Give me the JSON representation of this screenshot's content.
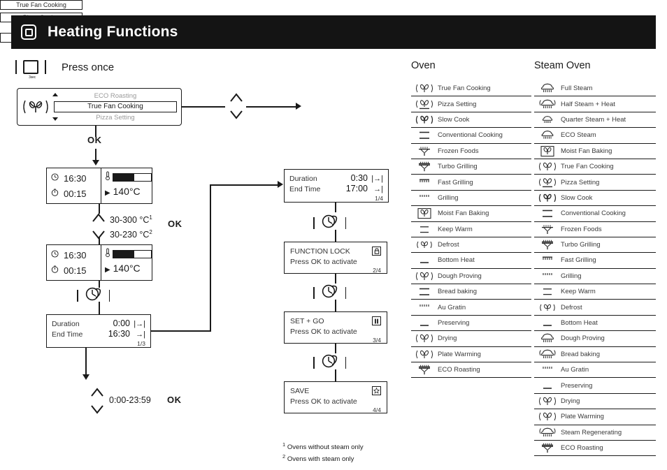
{
  "header": {
    "title": "Heating Functions",
    "icon": "square-button-icon"
  },
  "press_row": {
    "button_sublabel": "3sec",
    "label": "Press once"
  },
  "selector_panel": {
    "icon": "true-fan-cooking-icon",
    "option_above": "ECO Roasting",
    "option_selected": "True Fan Cooking",
    "option_below": "Pizza Setting"
  },
  "menu_panel": {
    "rows": [
      "True Fan Cooking",
      "Pizza Setting"
    ],
    "ellipsis": "....",
    "last_row": "ECO Roasting"
  },
  "ok_labels": {
    "after_selector": "OK",
    "after_temp": "OK",
    "after_duration": "OK"
  },
  "temp_display_1": {
    "clock_icon": "clock-icon",
    "clock_value": "16:30",
    "timer_icon": "timer-icon",
    "timer_value": "00:15",
    "thermo_icon": "thermometer-icon",
    "bar_fill_percent": 55,
    "temperature": "140°C"
  },
  "temp_display_2": {
    "clock_icon": "clock-icon",
    "clock_value": "16:30",
    "timer_icon": "timer-icon",
    "timer_value": "00:15",
    "thermo_icon": "thermometer-icon",
    "bar_fill_percent": 55,
    "temperature": "140°C"
  },
  "temp_range": {
    "line1": "30-300 °C",
    "sup1": "1",
    "line2": "30-230 °C",
    "sup2": "2"
  },
  "duration_display_1": {
    "duration_label": "Duration",
    "duration_value": "0:00",
    "duration_arrow": "|→|",
    "endtime_label": "End Time",
    "endtime_value": "16:30",
    "endtime_arrow": "→|",
    "page": "1/3"
  },
  "duration_range": "0:00-23:59",
  "duration_display_2": {
    "duration_label": "Duration",
    "duration_value": "0:30",
    "duration_arrow": "|→|",
    "endtime_label": "End Time",
    "endtime_value": "17:00",
    "endtime_arrow": "→|",
    "page": "1/4"
  },
  "function_lock": {
    "title": "FUNCTION LOCK",
    "glyph": "lock-icon",
    "subtitle": "Press OK to activate",
    "page": "2/4"
  },
  "set_and_go": {
    "title": "SET + GO",
    "glyph": "pause-icon",
    "subtitle": "Press OK to activate",
    "page": "3/4"
  },
  "save": {
    "title": "SAVE",
    "glyph": "star-icon",
    "subtitle": "Press OK to activate",
    "page": "4/4"
  },
  "footnotes": {
    "note1_sup": "1",
    "note1": "Ovens without steam only",
    "note2_sup": "2",
    "note2": "Ovens with steam only"
  },
  "oven_column": {
    "title": "Oven",
    "functions": [
      {
        "name": "True Fan Cooking",
        "icon": "fan-parens-icon"
      },
      {
        "name": "Pizza Setting",
        "icon": "fan-underline-icon"
      },
      {
        "name": "Slow Cook",
        "icon": "fan-bold-parens-icon"
      },
      {
        "name": "Conventional Cooking",
        "icon": "two-bars-icon"
      },
      {
        "name": "Frozen Foods",
        "icon": "frozen-foods-icon"
      },
      {
        "name": "Turbo Grilling",
        "icon": "turbo-grilling-icon"
      },
      {
        "name": "Fast Grilling",
        "icon": "fast-grill-icon"
      },
      {
        "name": "Grilling",
        "icon": "grill-icon"
      },
      {
        "name": "Moist Fan Baking",
        "icon": "moist-fan-baking-icon"
      },
      {
        "name": "Keep Warm",
        "icon": "two-bars-thin-icon"
      },
      {
        "name": "Defrost",
        "icon": "fan-small-parens-icon"
      },
      {
        "name": "Bottom Heat",
        "icon": "bottom-bar-icon"
      },
      {
        "name": "Dough Proving",
        "icon": "fan-parens-icon"
      },
      {
        "name": "Bread baking",
        "icon": "two-bars-icon"
      },
      {
        "name": "Au Gratin",
        "icon": "grill-icon"
      },
      {
        "name": "Preserving",
        "icon": "bottom-bar-icon"
      },
      {
        "name": "Drying",
        "icon": "fan-parens-icon"
      },
      {
        "name": "Plate Warming",
        "icon": "fan-parens-icon"
      },
      {
        "name": "ECO Roasting",
        "icon": "turbo-grilling-icon"
      }
    ]
  },
  "steam_oven_column": {
    "title": "Steam Oven",
    "functions": [
      {
        "name": "Full Steam",
        "icon": "full-steam-icon"
      },
      {
        "name": "Half Steam + Heat",
        "icon": "half-steam-icon"
      },
      {
        "name": "Quarter Steam + Heat",
        "icon": "quarter-steam-icon"
      },
      {
        "name": "ECO Steam",
        "icon": "eco-steam-icon"
      },
      {
        "name": "Moist Fan Baking",
        "icon": "moist-fan-baking-icon"
      },
      {
        "name": "True Fan Cooking",
        "icon": "fan-parens-icon"
      },
      {
        "name": "Pizza Setting",
        "icon": "fan-underline-icon"
      },
      {
        "name": "Slow Cook",
        "icon": "fan-bold-parens-icon"
      },
      {
        "name": "Conventional Cooking",
        "icon": "two-bars-icon"
      },
      {
        "name": "Frozen Foods",
        "icon": "frozen-foods-icon"
      },
      {
        "name": "Turbo Grilling",
        "icon": "turbo-grilling-icon"
      },
      {
        "name": "Fast Grilling",
        "icon": "fast-grill-icon"
      },
      {
        "name": "Grilling",
        "icon": "grill-icon"
      },
      {
        "name": "Keep Warm",
        "icon": "two-bars-thin-icon"
      },
      {
        "name": "Defrost",
        "icon": "fan-small-parens-icon"
      },
      {
        "name": "Bottom Heat",
        "icon": "bottom-bar-icon"
      },
      {
        "name": "Dough Proving",
        "icon": "full-steam-icon"
      },
      {
        "name": "Bread baking",
        "icon": "half-steam-icon"
      },
      {
        "name": "Au Gratin",
        "icon": "grill-icon"
      },
      {
        "name": "Preserving",
        "icon": "bottom-bar-icon"
      },
      {
        "name": "Drying",
        "icon": "fan-parens-icon"
      },
      {
        "name": "Plate Warming",
        "icon": "fan-parens-icon"
      },
      {
        "name": "Steam Regenerating",
        "icon": "half-steam-icon"
      },
      {
        "name": "ECO Roasting",
        "icon": "turbo-grilling-icon"
      }
    ]
  },
  "colors": {
    "ink": "#1a1a1a",
    "header_bg": "#141414",
    "muted": "#9a9a9a"
  }
}
